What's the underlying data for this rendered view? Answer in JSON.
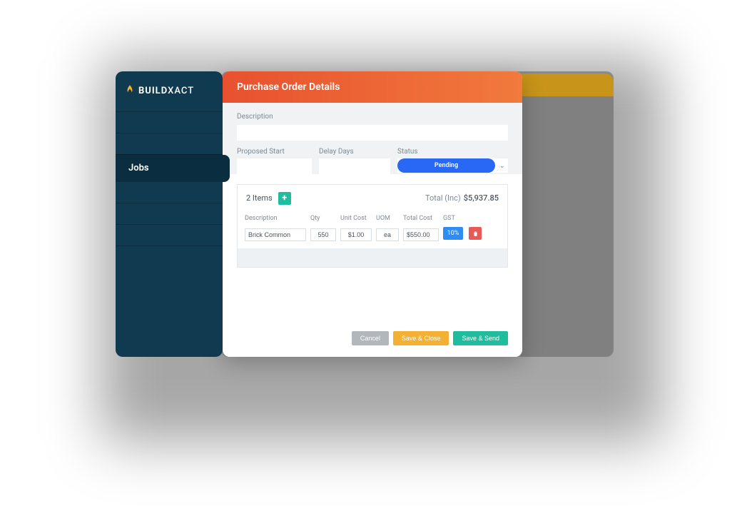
{
  "brand": {
    "prefix": "BUILD",
    "suffix": "XACT"
  },
  "sidebar": {
    "active_label": "Jobs"
  },
  "modal": {
    "title": "Purchase Order Details",
    "fields": {
      "description_label": "Description",
      "description_value": "",
      "proposed_start_label": "Proposed Start",
      "proposed_start_value": "",
      "delay_days_label": "Delay Days",
      "delay_days_value": "",
      "status_label": "Status",
      "status_value": "Pending"
    },
    "items": {
      "count_label": "2 Items",
      "total_label": "Total (Inc)",
      "total_amount": "$5,937.85",
      "columns": {
        "description": "Description",
        "qty": "Qty",
        "unit_cost": "Unit Cost",
        "uom": "UOM",
        "total_cost": "Total Cost",
        "gst": "GST"
      },
      "rows": [
        {
          "description": "Brick Common",
          "qty": "550",
          "unit_cost": "$1.00",
          "uom": "ea",
          "total_cost": "$550.00",
          "gst": "10%"
        }
      ]
    },
    "buttons": {
      "cancel": "Cancel",
      "save_close": "Save & Close",
      "save_send": "Save & Send"
    }
  }
}
